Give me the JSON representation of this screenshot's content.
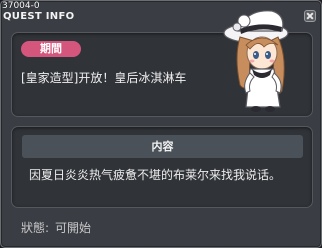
{
  "quest_id": "37004-0",
  "window_title": "QUEST INFO",
  "period": {
    "badge": "期間",
    "text": "[皇家造型]开放！皇后冰淇淋车"
  },
  "content": {
    "header": "内容",
    "text": "因夏日炎炎热气疲惫不堪的布莱尔来找我说话。"
  },
  "status": {
    "label": "狀態:",
    "value": "可開始"
  },
  "icons": [
    "close-icon",
    "npc-portrait"
  ],
  "colors": {
    "badge": "#d5567d",
    "panel": "#303338",
    "window": "#3a3d43",
    "header": "#4a5158"
  }
}
